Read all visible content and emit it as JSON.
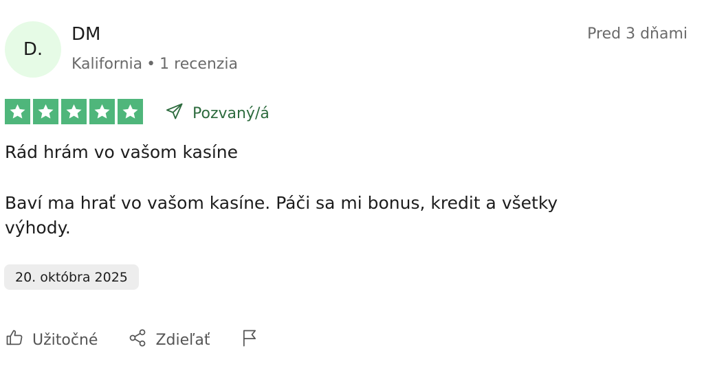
{
  "reviewer": {
    "initials": "D.",
    "name": "DM",
    "location": "Kalifornia",
    "separator": "•",
    "review_count": "1 recenzia",
    "age": "Pred 3 dňami"
  },
  "rating": {
    "stars": 5,
    "max_stars": 5,
    "star_color": "#4fb67b",
    "invited_label": "Pozvaný/á",
    "invited_icon": "send-icon"
  },
  "review": {
    "title": "Rád hrám vo vašom kasíne",
    "body": "Baví ma hrať vo vašom kasíne. Páči sa mi bonus, kredit a všetky výhody.",
    "date": "20. októbra 2025"
  },
  "actions": {
    "helpful_label": "Užitočné",
    "helpful_icon": "thumbs-up-icon",
    "share_label": "Zdieľať",
    "share_icon": "share-icon",
    "report_icon": "flag-icon"
  }
}
